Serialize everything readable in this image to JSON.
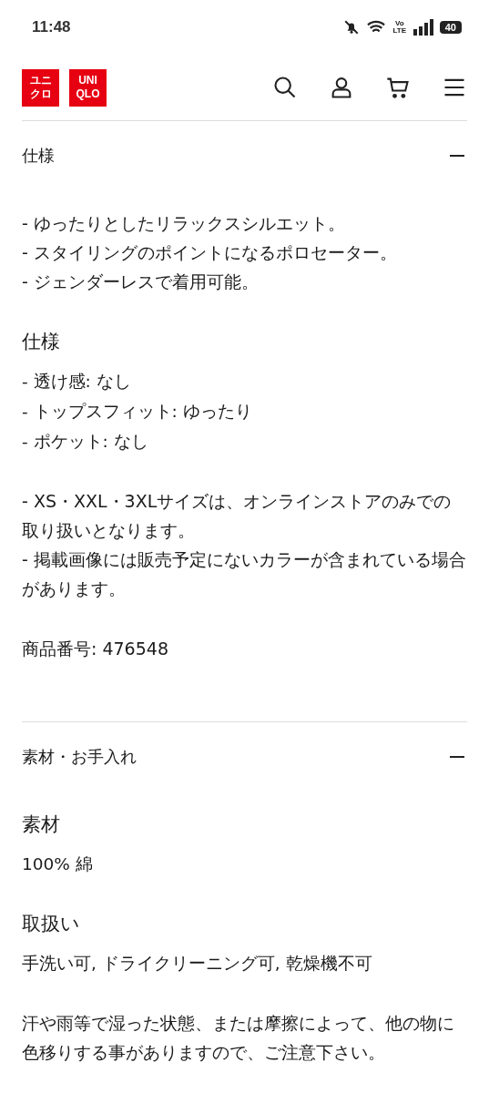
{
  "status_bar": {
    "time": "11:48",
    "network": "Vo LTE",
    "battery": "40"
  },
  "header": {
    "logo": [
      {
        "lines": [
          "ユニ",
          "クロ"
        ]
      },
      {
        "lines": [
          "UNI",
          "QLO"
        ]
      }
    ]
  },
  "sections": [
    {
      "title": "仕様",
      "expanded": true,
      "blocks": [
        {
          "kind": "paragraph",
          "lines": [
            "- ゆったりとしたリラックスシルエット。",
            "- スタイリングのポイントになるポロセーター。",
            "- ジェンダーレスで着用可能。"
          ]
        },
        {
          "kind": "heading",
          "text": "仕様"
        },
        {
          "kind": "list",
          "lines": [
            "- 透け感: なし",
            "- トップスフィット: ゆったり",
            "- ポケット: なし"
          ]
        },
        {
          "kind": "paragraph",
          "lines": [
            "- XS・XXL・3XLサイズは、オンラインストアのみでの取り扱いとなります。",
            "- 掲載画像には販売予定にないカラーが含まれている場合があります。"
          ]
        },
        {
          "kind": "paragraph",
          "lines": [
            "商品番号: 476548"
          ]
        }
      ]
    },
    {
      "title": "素材・お手入れ",
      "expanded": true,
      "blocks": [
        {
          "kind": "heading",
          "text": "素材"
        },
        {
          "kind": "list",
          "lines": [
            "100% 綿"
          ]
        },
        {
          "kind": "heading",
          "text": "取扱い"
        },
        {
          "kind": "list",
          "lines": [
            "手洗い可, ドライクリーニング可, 乾燥機不可"
          ]
        },
        {
          "kind": "paragraph",
          "lines": [
            "汗や雨等で湿った状態、または摩擦によって、他の物に色移りする事がありますので、ご注意下さい。"
          ]
        }
      ]
    }
  ]
}
